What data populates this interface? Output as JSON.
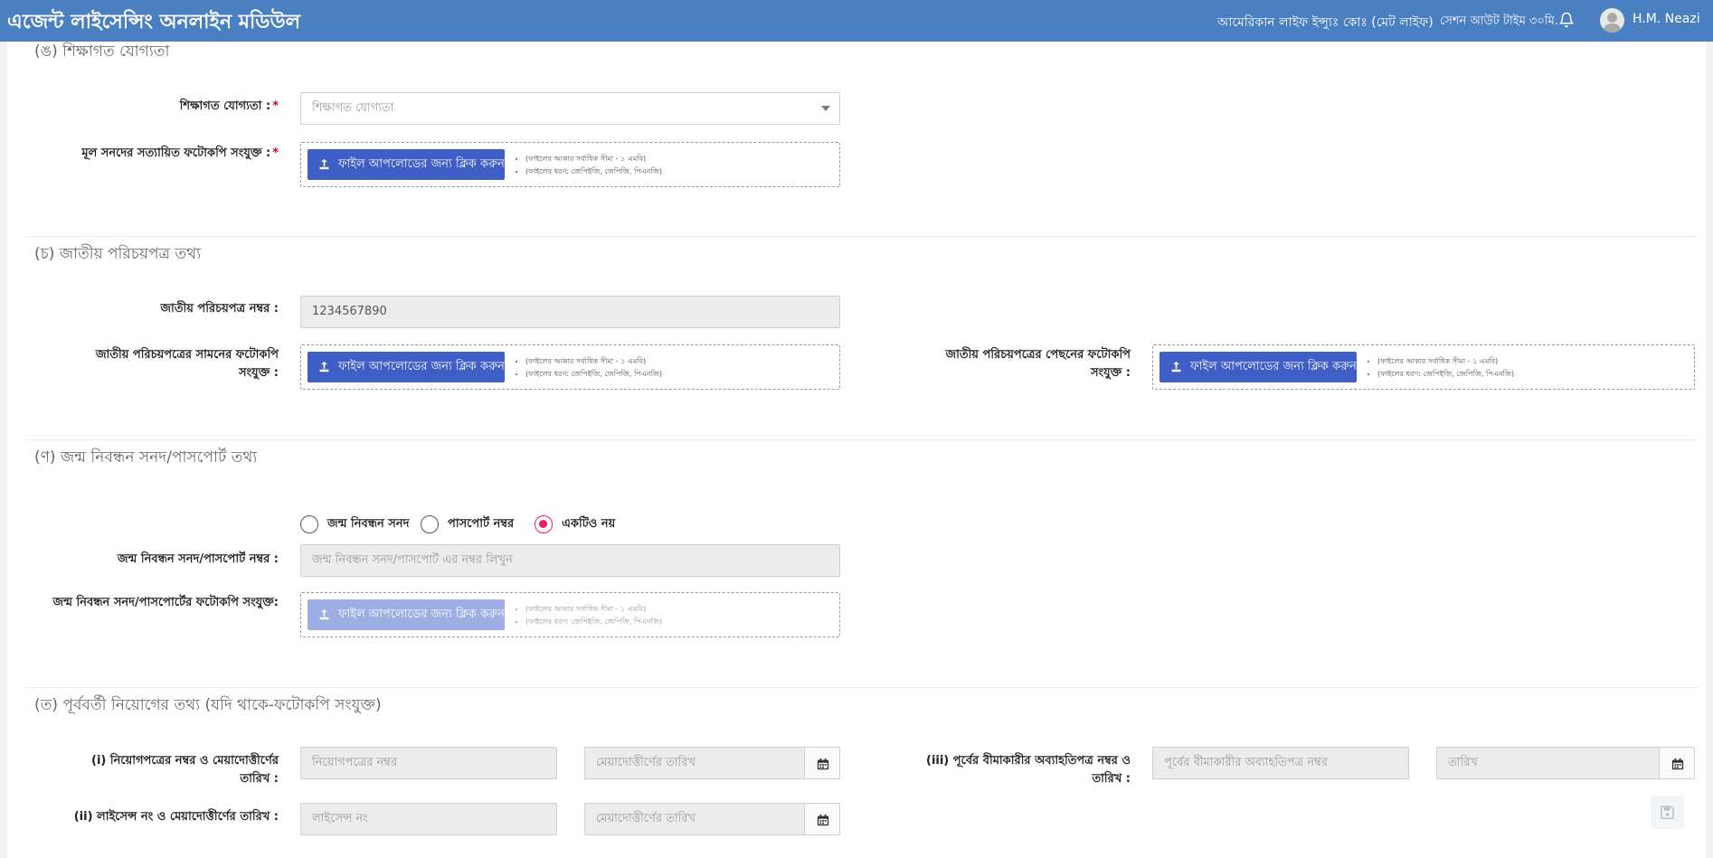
{
  "header": {
    "app_title": "এজেন্ট লাইসেন্সিং অনলাইন মডিউল",
    "company": "আমেরিকান লাইফ ইন্স্যুঃ কোঃ (মেট লাইফ)",
    "session": "সেশন আউট টাইম ৩০মি.",
    "username": "H.M. Neazi"
  },
  "upload": {
    "button_label": "ফাইল আপলোডের জন্য ক্লিক করুন",
    "note_size": "(ফাইলের আকার সর্বাধিক সীমা - ১ এমবি)",
    "note_type": "(ফাইলের ধরণ: জেপিইজি, জেপিজি, পিএনজি)"
  },
  "education": {
    "title": "(ঙ) শিক্ষাগত যোগ্যতা",
    "qualification_label": "শিক্ষাগত যোগ্যতা :",
    "qualification_placeholder": "শিক্ষাগত যোগ্যতা",
    "certificate_label": "মূল সনদের সত্যায়িত ফটোকপি সংযুক্ত :"
  },
  "nid": {
    "title": "(চ) জাতীয় পরিচয়পত্র তথ্য",
    "number_label": "জাতীয় পরিচয়পত্র নম্বর :",
    "number_value": "1234567890",
    "front_label_1": "জাতীয় পরিচয়পত্রের সামনের ফটোকপি",
    "front_label_2": "সংযুক্ত :",
    "back_label_1": "জাতীয় পরিচয়পত্রের পেছনের ফটোকপি",
    "back_label_2": "সংযুক্ত :"
  },
  "birth": {
    "title": "(ণ) জন্ম নিবন্ধন সনদ/পাসপোর্ট তথ্য",
    "options": [
      "জন্ম নিবন্ধন সনদ",
      "পাসপোর্ট নম্বর",
      "একটিও নয়"
    ],
    "selected": "একটিও নয়",
    "number_label": "জন্ম নিবন্ধন সনদ/পাসপোর্ট নম্বর :",
    "number_placeholder": "জন্ম নিবন্ধন সনদ/পাসপোর্ট এর নম্বর লিখুন",
    "copy_label": "জন্ম নিবন্ধন সনদ/পাসপোর্টের ফটোকপি সংযুক্ত:"
  },
  "previous": {
    "title": "(ত) পূর্ববর্তী নিয়োগের তথ্য (যদি থাকে-ফটোকপি সংযুক্ত)",
    "row1_label_1": "(i) নিয়োগপত্রের নম্বর ও মেয়াদোত্তীর্ণের",
    "row1_label_2": "তারিখ :",
    "appointment_placeholder": "নিয়োগপত্রের নম্বর",
    "expiry_placeholder": "মেয়াদোত্তীর্ণের তারিখ",
    "row2_label": "(ii) লাইসেন্স নং ও মেয়াদোত্তীর্ণের তারিখ :",
    "license_placeholder": "লাইসেন্স নং",
    "row3_label_1": "(iii) পূর্বের বীমাকারীর অব্যাহতিপত্র নম্বর ও",
    "row3_label_2": "তারিখ :",
    "release_placeholder": "পূর্বের বীমাকারীর অব্যাহতিপত্র নম্বর",
    "date_placeholder": "তারিখ"
  }
}
